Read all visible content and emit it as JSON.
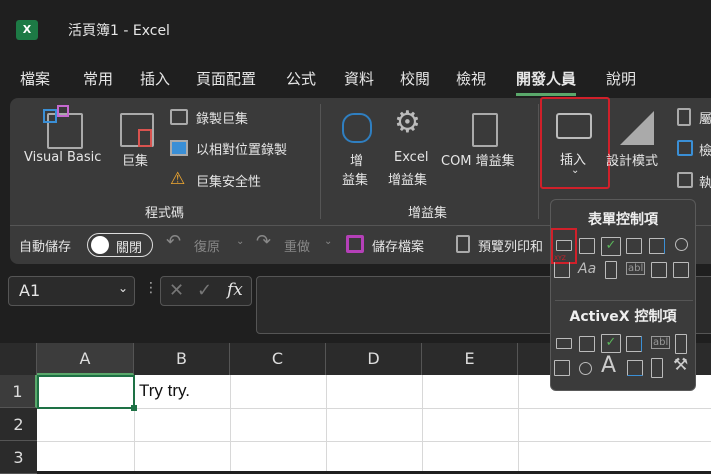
{
  "window": {
    "title": "活頁簿1  -  Excel",
    "app_icon": "X"
  },
  "menu": {
    "tabs": [
      "檔案",
      "常用",
      "插入",
      "頁面配置",
      "公式",
      "資料",
      "校閱",
      "檢視",
      "開發人員",
      "說明"
    ],
    "active": "開發人員"
  },
  "ribbon": {
    "code": {
      "visual_basic": "Visual Basic",
      "macros": "巨集",
      "record_macro": "錄製巨集",
      "relative": "以相對位置錄製",
      "security": "巨集安全性",
      "group": "程式碼"
    },
    "addins": {
      "addins_l1": "增",
      "addins_l2": "益集",
      "excel_l1": "Excel",
      "excel_l2": "增益集",
      "com": "COM 增益集",
      "group": "增益集"
    },
    "controls": {
      "insert": "插入",
      "design_mode": "設計模式",
      "properties": "屬",
      "view_code": "檢",
      "run_dialog": "執"
    }
  },
  "quick_access": {
    "autosave": "自動儲存",
    "toggle": "關閉",
    "undo": "復原",
    "redo": "重做",
    "save": "儲存檔案",
    "print_preview": "預覽列印和"
  },
  "formula_bar": {
    "name_box": "A1",
    "fx": "fx"
  },
  "sheet": {
    "columns": [
      "A",
      "B",
      "C",
      "D",
      "E"
    ],
    "rows": [
      "1",
      "2",
      "3"
    ],
    "cells": {
      "B1": "Try try."
    }
  },
  "dropdown": {
    "form_controls": "表單控制項",
    "activex_controls": "ActiveX 控制項",
    "xyz": "XYZ",
    "aa": "Aa",
    "abl": "abl",
    "big_a": "A"
  },
  "colors": {
    "accent": "#5aa86b",
    "highlight": "#d0202a"
  }
}
